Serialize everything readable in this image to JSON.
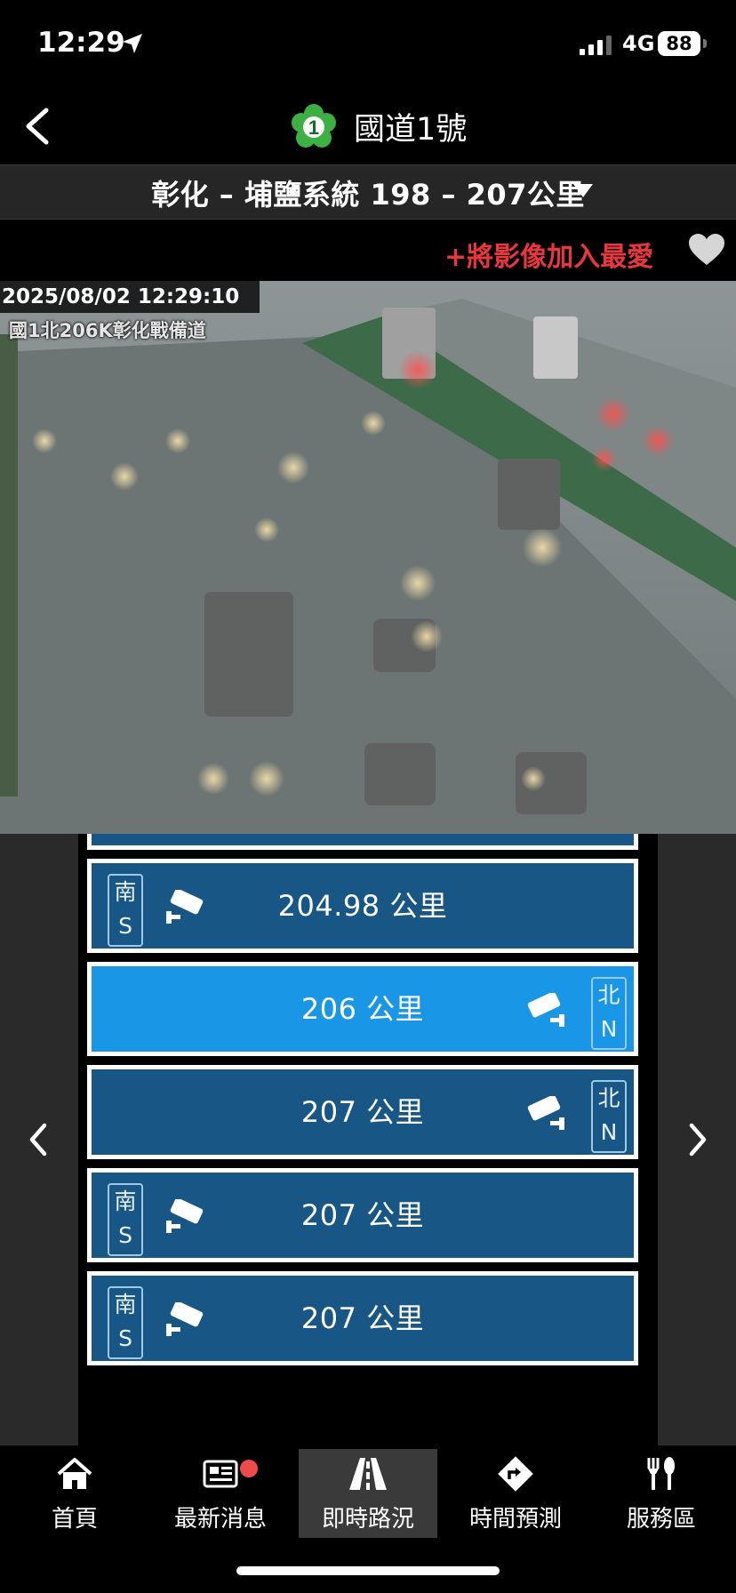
{
  "status_bar": {
    "time": "12:29",
    "network": "4G",
    "battery": "88"
  },
  "nav": {
    "title": "國道1號",
    "route_number": "1"
  },
  "section": {
    "label": "彰化 – 埔鹽系統 198 – 207公里"
  },
  "favorite": {
    "label": "+將影像加入最愛"
  },
  "camera": {
    "timestamp": "2025/08/02 12:29:10",
    "location": "國1北206K彰化戰備道"
  },
  "list": [
    {
      "label": "204.98 公里",
      "dir_zh": "南",
      "dir_en": "S",
      "side": "left",
      "active": false
    },
    {
      "label": "206 公里",
      "dir_zh": "北",
      "dir_en": "N",
      "side": "right",
      "active": true
    },
    {
      "label": "207 公里",
      "dir_zh": "北",
      "dir_en": "N",
      "side": "right",
      "active": false
    },
    {
      "label": "207 公里",
      "dir_zh": "南",
      "dir_en": "S",
      "side": "left",
      "active": false
    },
    {
      "label": "207 公里",
      "dir_zh": "南",
      "dir_en": "S",
      "side": "left",
      "active": false
    }
  ],
  "tabs": [
    {
      "label": "首頁",
      "icon": "home-icon"
    },
    {
      "label": "最新消息",
      "icon": "news-icon"
    },
    {
      "label": "即時路況",
      "icon": "road-icon"
    },
    {
      "label": "時間預測",
      "icon": "route-icon"
    },
    {
      "label": "服務區",
      "icon": "fork-knife-icon"
    }
  ],
  "colors": {
    "row": "#175685",
    "row_active": "#1a96e6",
    "accent_red": "#e8373d",
    "tab_active": "#3a3a3a"
  }
}
